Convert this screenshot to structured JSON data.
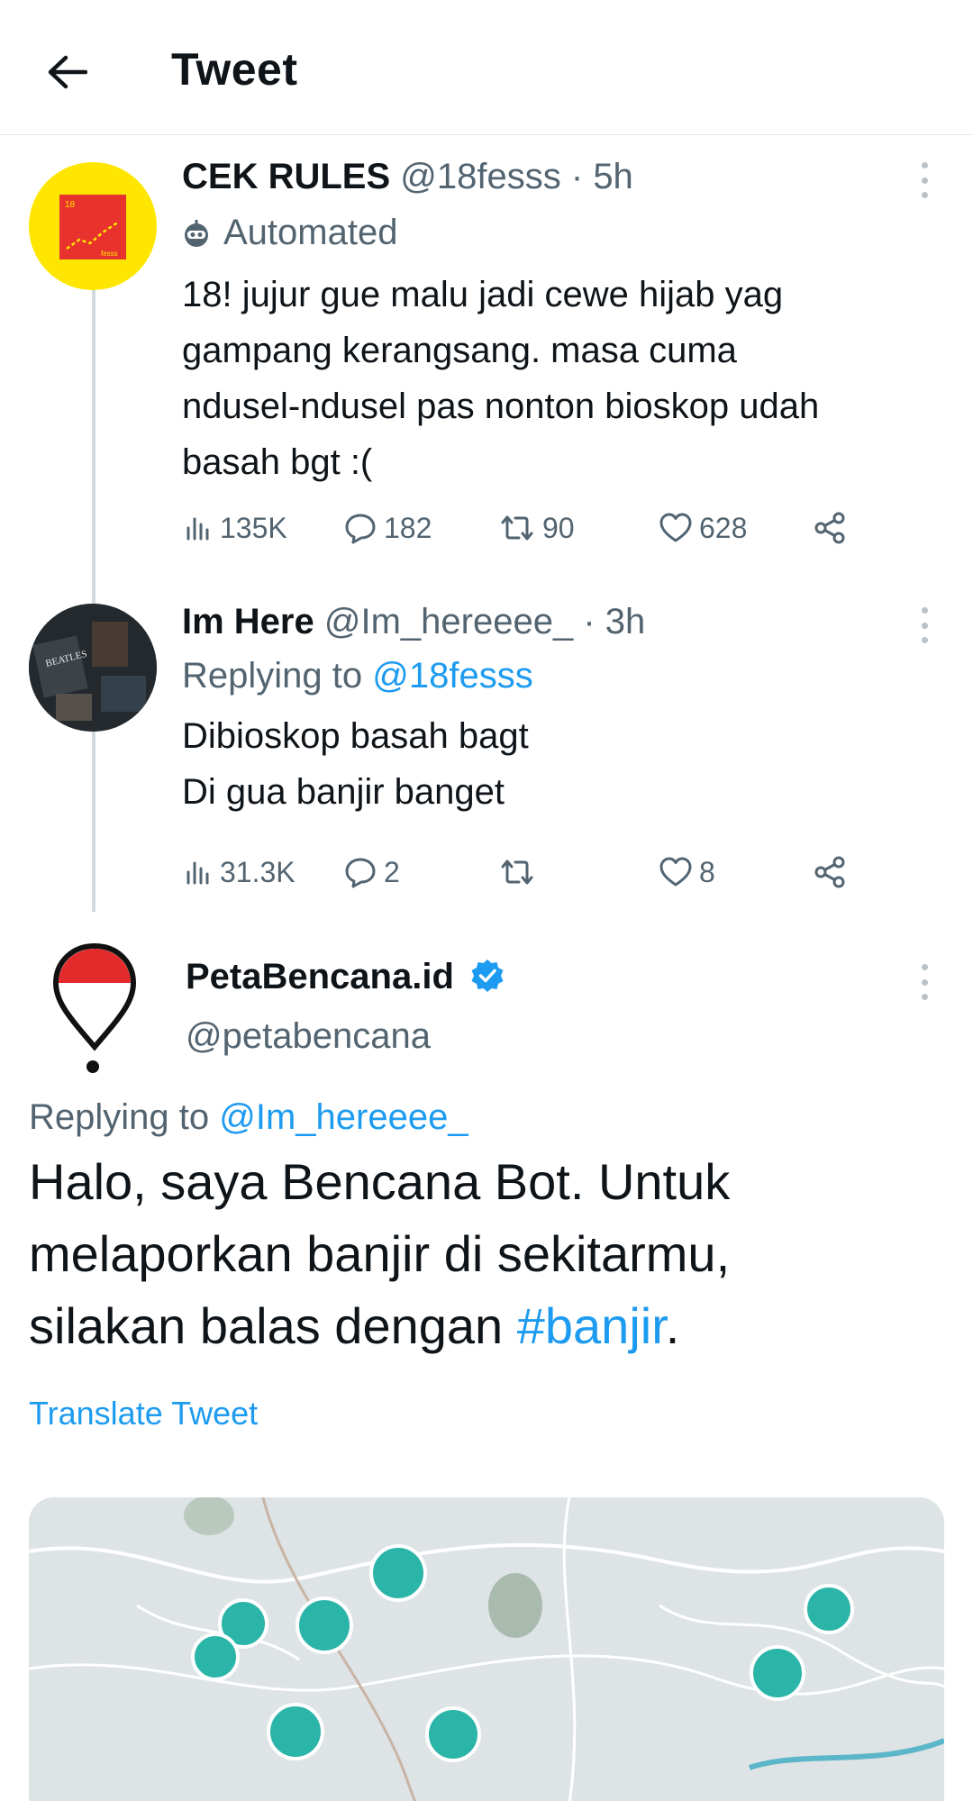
{
  "header": {
    "title": "Tweet",
    "back_icon": "arrow-left-icon"
  },
  "tweets": [
    {
      "name": "CEK RULES",
      "handle": "@18fesss",
      "dot": "·",
      "time": "5h",
      "badge_label": "Automated",
      "badge_icon": "robot-icon",
      "avatar_text_top": "18",
      "avatar_text_bottom": "fesss",
      "text_lines": [
        "18! jujur gue malu jadi cewe hijab yag",
        "gampang kerangsang. masa cuma",
        "ndusel-ndusel pas nonton bioskop udah",
        "basah bgt :("
      ],
      "views": "135K",
      "replies": "182",
      "retweets": "90",
      "likes": "628"
    },
    {
      "name": "Im Here",
      "handle": "@Im_hereeee_",
      "dot": "·",
      "time": "3h",
      "replying_label": "Replying to",
      "replying_handle": "@18fesss",
      "avatar_text": "BEATLES",
      "text_lines": [
        "Dibioskop basah bagt",
        "Di gua banjir banget"
      ],
      "views": "31.3K",
      "replies": "2",
      "retweets": "",
      "likes": "8"
    },
    {
      "name": "PetaBencana.id",
      "handle": "@petabencana",
      "verified": true,
      "replying_label": "Replying to",
      "replying_handle": "@Im_hereeee_",
      "text_lines": [
        "Halo, saya Bencana Bot. Untuk",
        "melaporkan banjir di sekitarmu,",
        "silakan balas dengan "
      ],
      "hashtag": "#banjir",
      "text_end": ".",
      "translate_label": "Translate Tweet"
    }
  ],
  "colors": {
    "link": "#1d9bf0",
    "secondary": "#536471",
    "map_marker": "#2bb5a8",
    "avatar_yellow": "#ffe600",
    "avatar_red": "#e8322d"
  }
}
